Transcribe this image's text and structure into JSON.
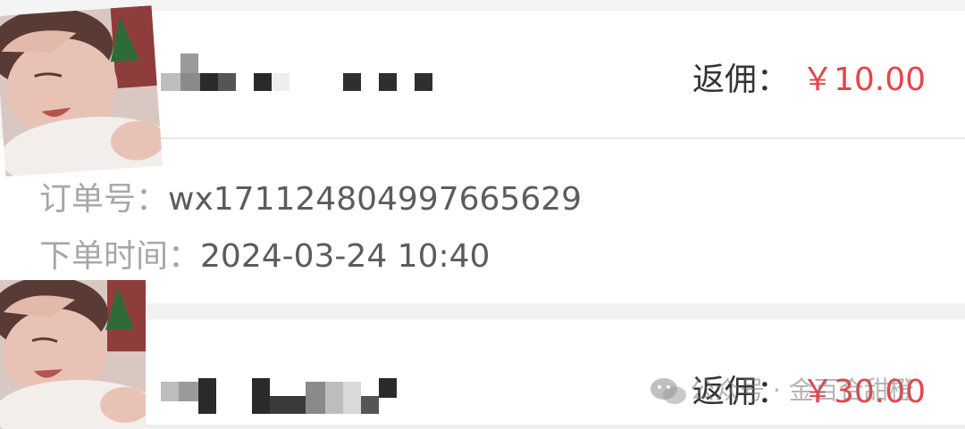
{
  "orders": [
    {
      "user_name": "",
      "commission_label": "返佣：",
      "commission_amount": "￥10.00",
      "order_no_label": "订单号：",
      "order_no": "wx17112480499766562​9",
      "order_time_label": "下单时间：",
      "order_time": "2024-03-24 10:40"
    },
    {
      "user_name": "",
      "commission_label": "返佣：",
      "commission_amount": "￥30.00"
    }
  ],
  "watermark": {
    "text": "公众号 · 金百合甜橙",
    "icon": "wechat-icon"
  },
  "colors": {
    "amount": "#e8434b",
    "label_gray": "#a7a7a7",
    "value_gray": "#5c5c5c",
    "text_dark": "#333333"
  }
}
